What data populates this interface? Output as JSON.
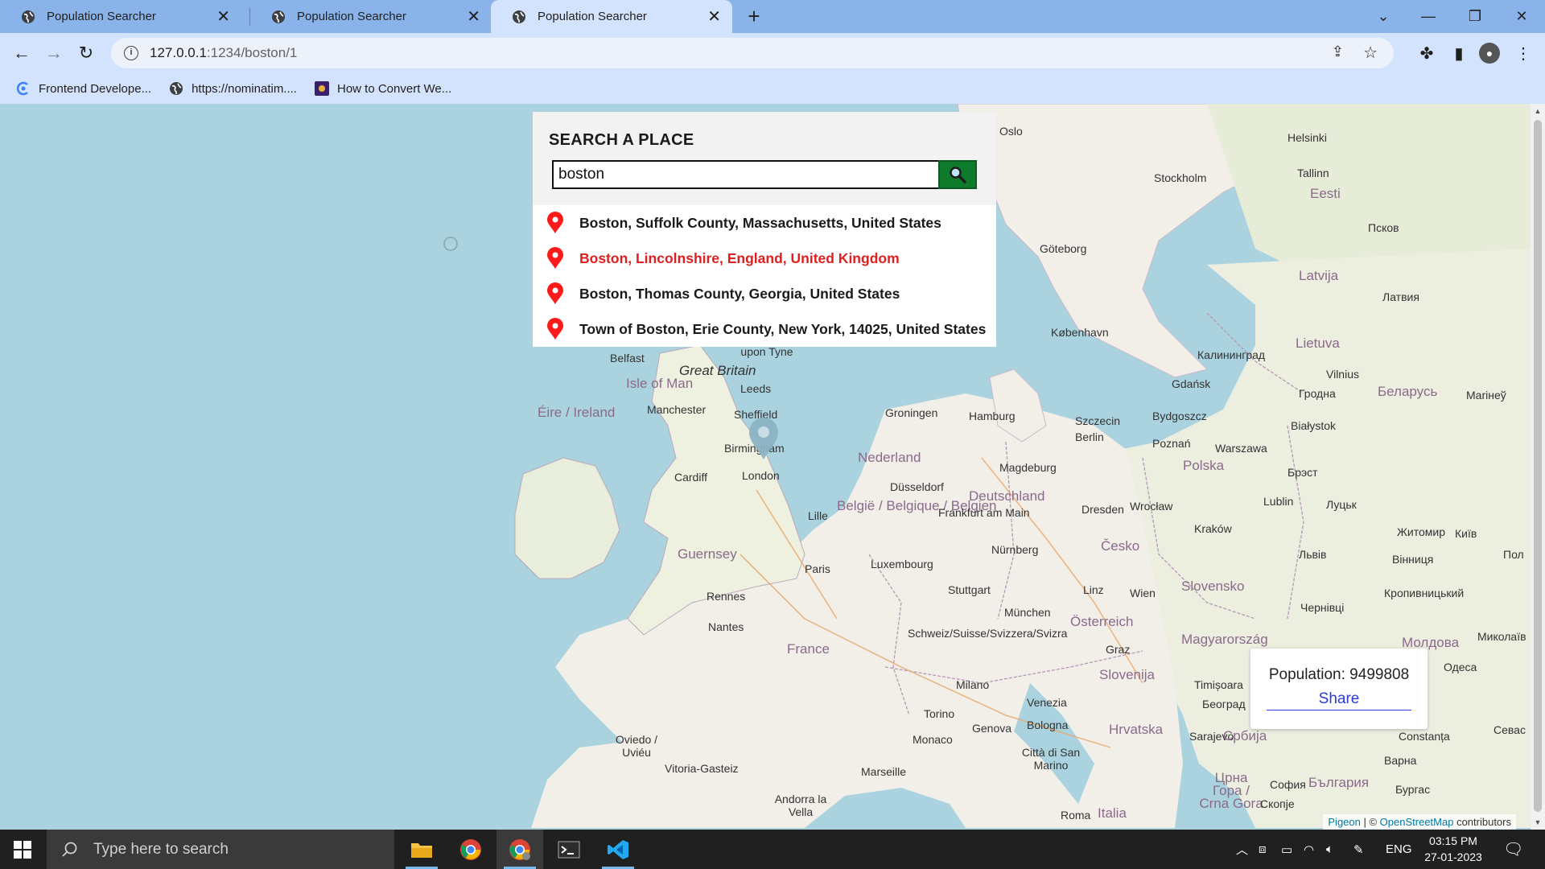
{
  "browser": {
    "tabs": [
      {
        "title": "Population Searcher",
        "active": false
      },
      {
        "title": "Population Searcher",
        "active": false
      },
      {
        "title": "Population Searcher",
        "active": true
      }
    ],
    "url_host": "127.0.0.1",
    "url_path": ":1234/boston/1",
    "bookmarks": [
      {
        "label": "Frontend Develope..."
      },
      {
        "label": "https://nominatim...."
      },
      {
        "label": "How to Convert We..."
      }
    ]
  },
  "search": {
    "title": "SEARCH A PLACE",
    "query": "boston",
    "results": [
      {
        "label": "Boston, Suffolk County, Massachusetts, United States",
        "highlighted": false
      },
      {
        "label": "Boston, Lincolnshire, England, United Kingdom",
        "highlighted": true
      },
      {
        "label": "Boston, Thomas County, Georgia, United States",
        "highlighted": false
      },
      {
        "label": "Town of Boston, Erie County, New York, 14025, United States",
        "highlighted": false
      }
    ]
  },
  "popup": {
    "population_text": "Population: 9499808",
    "share_label": "Share"
  },
  "attribution": {
    "pigeon": "Pigeon",
    "separator": " | © ",
    "osm": "OpenStreetMap",
    "suffix": " contributors"
  },
  "map_labels": [
    {
      "text": "Oslo",
      "kind": "city"
    },
    {
      "text": "Helsinki",
      "kind": "city"
    },
    {
      "text": "Stockholm",
      "kind": "city"
    },
    {
      "text": "Tallinn",
      "kind": "city"
    },
    {
      "text": "Eesti",
      "kind": "country"
    },
    {
      "text": "Göteborg",
      "kind": "city"
    },
    {
      "text": "Latvija",
      "kind": "country"
    },
    {
      "text": "København",
      "kind": "city"
    },
    {
      "text": "Lietuva",
      "kind": "country"
    },
    {
      "text": "Калининград",
      "kind": "city"
    },
    {
      "text": "Vilnius",
      "kind": "city"
    },
    {
      "text": "Беларусь",
      "kind": "country"
    },
    {
      "text": "Gdańsk",
      "kind": "city"
    },
    {
      "text": "Hamburg",
      "kind": "city"
    },
    {
      "text": "Szczecin",
      "kind": "city"
    },
    {
      "text": "Bydgoszcz",
      "kind": "city"
    },
    {
      "text": "Berlin",
      "kind": "city"
    },
    {
      "text": "Poznań",
      "kind": "city"
    },
    {
      "text": "Warszawa",
      "kind": "city"
    },
    {
      "text": "Białystok",
      "kind": "city"
    },
    {
      "text": "Polska",
      "kind": "country"
    },
    {
      "text": "Nederland",
      "kind": "country"
    },
    {
      "text": "Groningen",
      "kind": "city"
    },
    {
      "text": "Deutschland",
      "kind": "country"
    },
    {
      "text": "Magdeburg",
      "kind": "city"
    },
    {
      "text": "Dresden",
      "kind": "city"
    },
    {
      "text": "Wrocław",
      "kind": "city"
    },
    {
      "text": "Lublin",
      "kind": "city"
    },
    {
      "text": "Kraków",
      "kind": "city"
    },
    {
      "text": "Česko",
      "kind": "country"
    },
    {
      "text": "Düsseldorf",
      "kind": "city"
    },
    {
      "text": "België / Belgique / Belgien",
      "kind": "country"
    },
    {
      "text": "Frankfurt am Main",
      "kind": "city"
    },
    {
      "text": "Nürnberg",
      "kind": "city"
    },
    {
      "text": "Luxembourg",
      "kind": "city"
    },
    {
      "text": "Paris",
      "kind": "city"
    },
    {
      "text": "Stuttgart",
      "kind": "city"
    },
    {
      "text": "München",
      "kind": "city"
    },
    {
      "text": "Linz",
      "kind": "city"
    },
    {
      "text": "Wien",
      "kind": "city"
    },
    {
      "text": "Slovensko",
      "kind": "country"
    },
    {
      "text": "Österreich",
      "kind": "country"
    },
    {
      "text": "Magyarország",
      "kind": "country"
    },
    {
      "text": "France",
      "kind": "country"
    },
    {
      "text": "Rennes",
      "kind": "city"
    },
    {
      "text": "Nantes",
      "kind": "city"
    },
    {
      "text": "Schweiz/Suisse/Svizzera/Svizra",
      "kind": "country"
    },
    {
      "text": "Graz",
      "kind": "city"
    },
    {
      "text": "Slovenija",
      "kind": "country"
    },
    {
      "text": "Milano",
      "kind": "city"
    },
    {
      "text": "Venezia",
      "kind": "city"
    },
    {
      "text": "Torino",
      "kind": "city"
    },
    {
      "text": "Genova",
      "kind": "city"
    },
    {
      "text": "Bologna",
      "kind": "city"
    },
    {
      "text": "Hrvatska",
      "kind": "country"
    },
    {
      "text": "Monaco",
      "kind": "city"
    },
    {
      "text": "Marseille",
      "kind": "city"
    },
    {
      "text": "Città di San Marino",
      "kind": "city"
    },
    {
      "text": "Oviedo / Uviéu",
      "kind": "city"
    },
    {
      "text": "Vitoria-Gasteiz",
      "kind": "city"
    },
    {
      "text": "Andorra la Vella",
      "kind": "city"
    },
    {
      "text": "Roma",
      "kind": "city"
    },
    {
      "text": "Italia",
      "kind": "country"
    },
    {
      "text": "Éire / Ireland",
      "kind": "country"
    },
    {
      "text": "Belfast",
      "kind": "city"
    },
    {
      "text": "Isle of Man",
      "kind": "country"
    },
    {
      "text": "Great Britain",
      "kind": "country"
    },
    {
      "text": "Newcastle upon Tyne",
      "kind": "city"
    },
    {
      "text": "Leeds",
      "kind": "city"
    },
    {
      "text": "Manchester",
      "kind": "city"
    },
    {
      "text": "Sheffield",
      "kind": "city"
    },
    {
      "text": "Birmingham",
      "kind": "city"
    },
    {
      "text": "Cardiff",
      "kind": "city"
    },
    {
      "text": "London",
      "kind": "city"
    },
    {
      "text": "Lille",
      "kind": "city"
    },
    {
      "text": "Guernsey",
      "kind": "country"
    },
    {
      "text": "Латвия",
      "kind": "city"
    },
    {
      "text": "Гродна",
      "kind": "city"
    },
    {
      "text": "Брэст",
      "kind": "city"
    },
    {
      "text": "Луцьк",
      "kind": "city"
    },
    {
      "text": "Житомир",
      "kind": "city"
    },
    {
      "text": "Київ",
      "kind": "city"
    },
    {
      "text": "Львів",
      "kind": "city"
    },
    {
      "text": "Вінниця",
      "kind": "city"
    },
    {
      "text": "Кропивницький",
      "kind": "city"
    },
    {
      "text": "Чернівці",
      "kind": "city"
    },
    {
      "text": "Молдова",
      "kind": "country"
    },
    {
      "text": "Одеса",
      "kind": "city"
    },
    {
      "text": "Миколаїв",
      "kind": "city"
    },
    {
      "text": "Timișoara",
      "kind": "city"
    },
    {
      "text": "Београд",
      "kind": "city"
    },
    {
      "text": "Sarajevo",
      "kind": "city"
    },
    {
      "text": "Србија",
      "kind": "country"
    },
    {
      "text": "Црна Гора / Crna Gora",
      "kind": "country"
    },
    {
      "text": "Constanța",
      "kind": "city"
    },
    {
      "text": "Варна",
      "kind": "city"
    },
    {
      "text": "България",
      "kind": "country"
    },
    {
      "text": "София",
      "kind": "city"
    },
    {
      "text": "Бургас",
      "kind": "city"
    },
    {
      "text": "Скопје",
      "kind": "city"
    },
    {
      "text": "Псков",
      "kind": "city"
    },
    {
      "text": "Mariнеў",
      "kind": "city"
    },
    {
      "text": "Пол",
      "kind": "city"
    },
    {
      "text": "Севас",
      "kind": "city"
    }
  ],
  "taskbar": {
    "search_placeholder": "Type here to search",
    "language": "ENG",
    "time": "03:15 PM",
    "date": "27-01-2023"
  },
  "colors": {
    "search_button": "#0d7a2c",
    "result_hover": "#e02020",
    "pin_red": "#ff1a1a",
    "share_link": "#2a3bd8",
    "sea": "#aad3df",
    "land": "#f2efe9"
  }
}
